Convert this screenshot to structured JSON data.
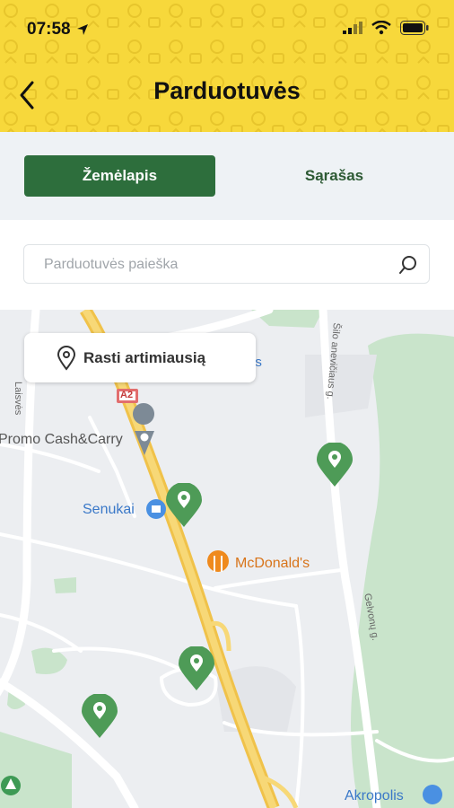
{
  "status_bar": {
    "time": "07:58"
  },
  "header": {
    "title": "Parduotuvės"
  },
  "tabs": [
    {
      "label": "Žemėlapis",
      "active": true
    },
    {
      "label": "Sąrašas",
      "active": false
    }
  ],
  "search": {
    "placeholder": "Parduotuvės paieška",
    "value": ""
  },
  "map": {
    "find_nearest_label": "Rasti artimiausią",
    "labels": {
      "promo": "Promo Cash&Carry",
      "senukai": "Senukai",
      "mcdonalds": "McDonald's",
      "akropolis": "Akropolis",
      "highway": "A2",
      "street_laisves": "Laisvės",
      "street_sevcenkos": "Šilo anevičiaus g.",
      "street_gelvonu": "Gelvonų g.",
      "partial_us": "us"
    },
    "store_pin_count": 4
  },
  "colors": {
    "header_yellow": "#f7d83b",
    "accent_green": "#2d6e3c",
    "pin_green": "#4e9b57",
    "tabs_bg": "#eef2f5"
  }
}
